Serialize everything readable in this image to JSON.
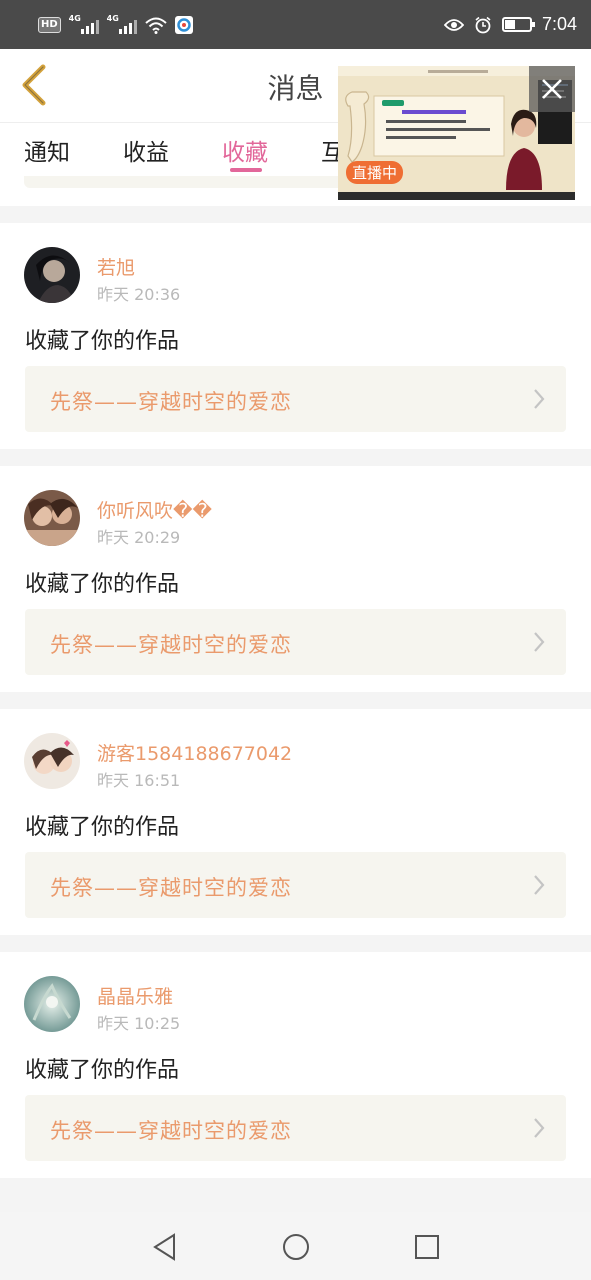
{
  "status_bar": {
    "hd": "HD",
    "net1": "4G",
    "net2": "4G",
    "time": "7:04",
    "icons": [
      "eye-icon",
      "alarm-icon",
      "battery-icon",
      "wifi-icon",
      "signal-icon"
    ]
  },
  "header": {
    "title": "消息",
    "back_icon": "chevron-left-icon",
    "accent_color": "#d3a23c"
  },
  "tabs": [
    {
      "label": "通知",
      "active": false
    },
    {
      "label": "收益",
      "active": false
    },
    {
      "label": "收藏",
      "active": true
    },
    {
      "label": "互",
      "active": false
    }
  ],
  "live_window": {
    "badge": "直播中",
    "close_icon": "close-icon"
  },
  "items": [
    {
      "name": "若旭",
      "time": "昨天 20:36",
      "action": "收藏了你的作品",
      "work": "先祭——穿越时空的爱恋"
    },
    {
      "name": "你听风吹��",
      "time": "昨天 20:29",
      "action": "收藏了你的作品",
      "work": "先祭——穿越时空的爱恋"
    },
    {
      "name": "游客1584188677042",
      "time": "昨天 16:51",
      "action": "收藏了你的作品",
      "work": "先祭——穿越时空的爱恋"
    },
    {
      "name": "晶晶乐雅",
      "time": "昨天 10:25",
      "action": "收藏了你的作品",
      "work": "先祭——穿越时空的爱恋"
    }
  ],
  "colors": {
    "accent_pink": "#e2679a",
    "name_orange": "#ea9a6c",
    "card_bg": "#f6f5ef",
    "live_badge": "#ef6e33"
  },
  "nav_icons": [
    "back-triangle-icon",
    "home-circle-icon",
    "recents-square-icon"
  ]
}
